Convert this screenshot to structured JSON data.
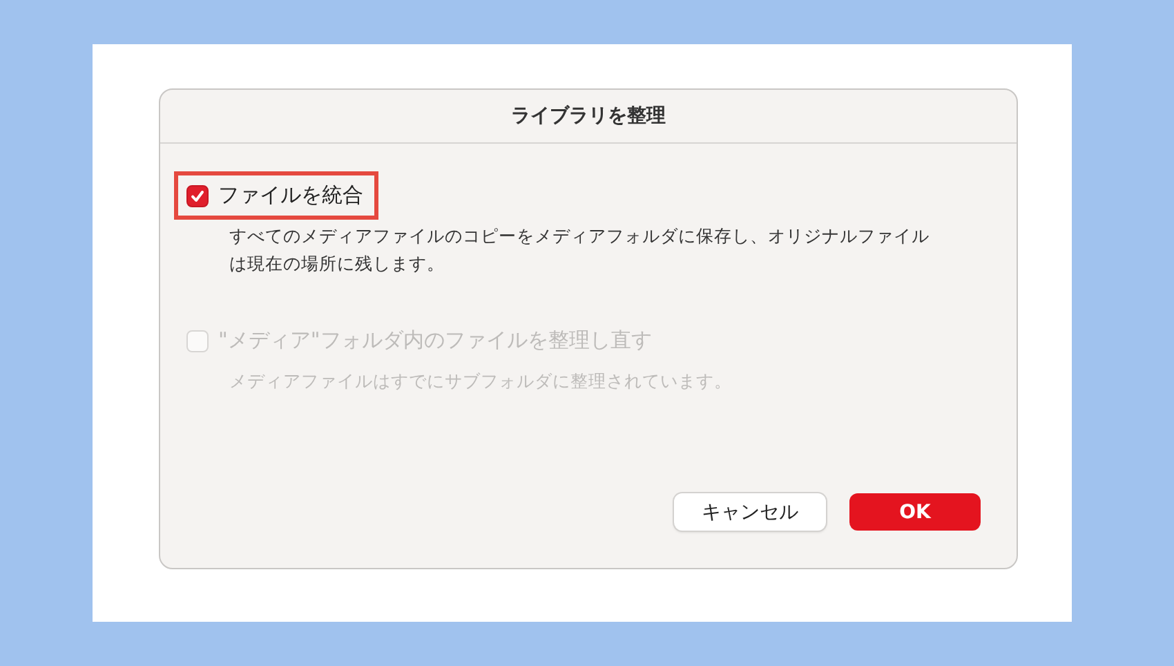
{
  "dialog": {
    "title": "ライブラリを整理"
  },
  "options": [
    {
      "label": "ファイルを統合",
      "description": "すべてのメディアファイルのコピーをメディアフォルダに保存し、オリジナルファイルは現在の場所に残します。",
      "checked": true,
      "disabled": false,
      "highlighted": true
    },
    {
      "label": "\"メディア\"フォルダ内のファイルを整理し直す",
      "description": "メディアファイルはすでにサブフォルダに整理されています。",
      "checked": false,
      "disabled": true,
      "highlighted": false
    }
  ],
  "buttons": [
    {
      "label": "キャンセル",
      "kind": "secondary"
    },
    {
      "label": "OK",
      "kind": "primary"
    }
  ]
}
